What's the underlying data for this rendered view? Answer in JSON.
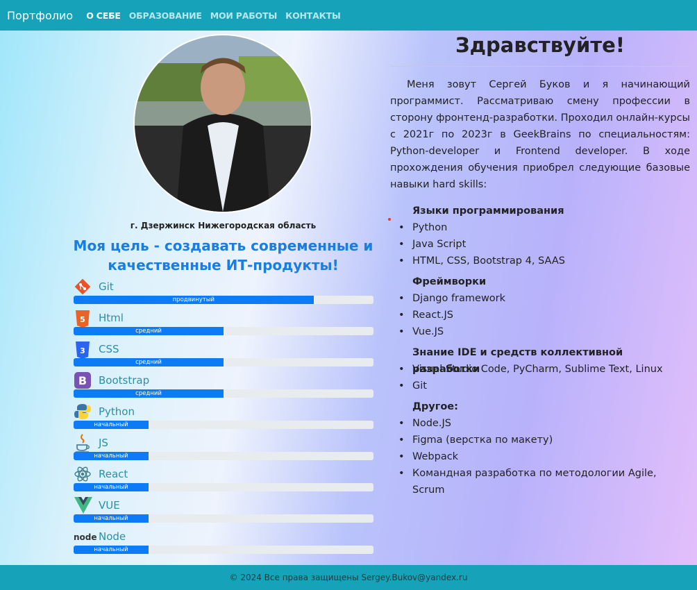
{
  "nav": {
    "brand": "Портфолио",
    "links": [
      "О себе",
      "Образование",
      "Мои работы",
      "Контакты"
    ]
  },
  "profile": {
    "city": "г. Дзержинск Нижегородская область",
    "goal": "Моя цель - создавать современные и качественные ИТ-продукты!"
  },
  "skills": [
    {
      "name": "Git",
      "level": "продвинутый",
      "percent": 80,
      "icon": "git-icon"
    },
    {
      "name": "Html",
      "level": "средний",
      "percent": 50,
      "icon": "html5-icon"
    },
    {
      "name": "CSS",
      "level": "средний",
      "percent": 50,
      "icon": "css3-icon"
    },
    {
      "name": "Bootstrap",
      "level": "средний",
      "percent": 50,
      "icon": "bootstrap-icon"
    },
    {
      "name": "Python",
      "level": "начальный",
      "percent": 25,
      "icon": "python-icon"
    },
    {
      "name": "JS",
      "level": "начальный",
      "percent": 25,
      "icon": "java-cup-icon"
    },
    {
      "name": "React",
      "level": "начальный",
      "percent": 25,
      "icon": "react-icon"
    },
    {
      "name": "VUE",
      "level": "начальный",
      "percent": 25,
      "icon": "vue-icon"
    },
    {
      "name": "Node",
      "level": "начальный",
      "percent": 25,
      "icon": "node-icon"
    }
  ],
  "about": {
    "greeting": "Здравствуйте!",
    "intro": "Меня зовут Сергей Буков и я начинающий программист. Рассматриваю смену профессии в сторону фронтенд-разработки. Проходил онлайн-курсы с 2021г по 2023г в GeekBrains по специальностям: Python-developer и Frontend developer. В ходе прохождения обучения приобрел следующие базовые навыки hard skills:",
    "categories": [
      {
        "title": "Языки программирования",
        "items": [
          "Python",
          "Java Script",
          "HTML, CSS, Bootstrap 4, SAAS"
        ]
      },
      {
        "title": "Фреймворки",
        "items": [
          "Django framework",
          "React.JS",
          "Vue.JS"
        ]
      },
      {
        "title": "Знание IDE и средств коллективной разработки",
        "items": [
          "Visual Studio Code, PyCharm, Sublime Text, Linux",
          "Git"
        ]
      },
      {
        "title": "Другое:",
        "items": [
          "Node.JS",
          "Figma (верстка по макету)",
          "Webpack",
          "Командная разработка по методологии Agile, Scrum"
        ]
      }
    ]
  },
  "footer": {
    "text": "© 2024 Все права защищены Sergey.Bukov@yandex.ru"
  },
  "colors": {
    "navbar": "#16a2b8",
    "progress": "#0d7bf5",
    "goal": "#1a7ee0"
  }
}
